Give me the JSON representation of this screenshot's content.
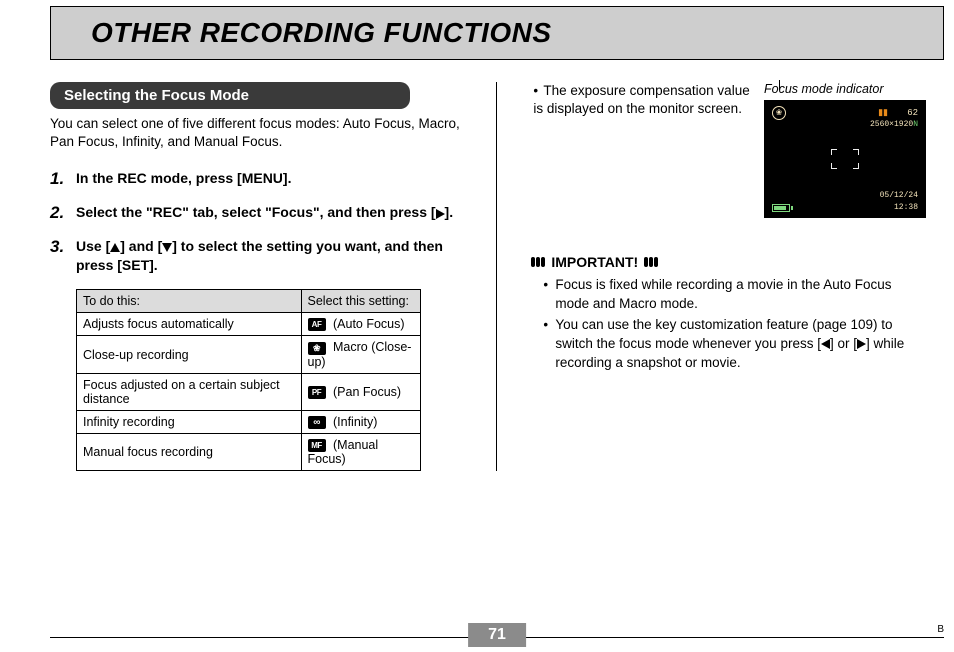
{
  "title": "OTHER RECORDING FUNCTIONS",
  "subheading": "Selecting the Focus Mode",
  "intro": "You can select one of five different focus modes: Auto Focus, Macro, Pan Focus, Infinity, and Manual Focus.",
  "steps": {
    "s1_num": "1.",
    "s1": "In the REC mode, press [MENU].",
    "s2_num": "2.",
    "s2a": "Select the \"REC\" tab, select \"Focus\", and then press [",
    "s2b": "].",
    "s3_num": "3.",
    "s3a": "Use [",
    "s3b": "] and [",
    "s3c": "] to select the setting you want, and then press [SET]."
  },
  "table": {
    "h1": "To do this:",
    "h2": "Select this setting:",
    "rows": [
      {
        "do": "Adjusts focus automatically",
        "icon": "AF",
        "label": "(Auto Focus)"
      },
      {
        "do": "Close-up recording",
        "icon": "flower",
        "label": "Macro (Close-up)"
      },
      {
        "do": "Focus adjusted on a certain subject distance",
        "icon": "PF",
        "label": "(Pan Focus)"
      },
      {
        "do": "Infinity recording",
        "icon": "infinity",
        "label": "(Infinity)"
      },
      {
        "do": "Manual focus recording",
        "icon": "MF",
        "label": "(Manual Focus)"
      }
    ]
  },
  "right": {
    "bullet": "The exposure compensation value is displayed on the monitor screen.",
    "caption": "Focus mode indicator",
    "screen": {
      "count": "62",
      "res": "2560×1920",
      "res_suffix": "N",
      "date": "05/12/24",
      "time": "12:38"
    },
    "important_label": "IMPORTANT!",
    "imp1": "Focus is fixed while recording a movie in the Auto Focus mode and Macro mode.",
    "imp2a": "You can use the key customization feature (page 109) to switch the focus mode whenever you press [",
    "imp2b": "] or [",
    "imp2c": "] while recording a snapshot or movie."
  },
  "page_number": "71",
  "footer_mark": "B"
}
